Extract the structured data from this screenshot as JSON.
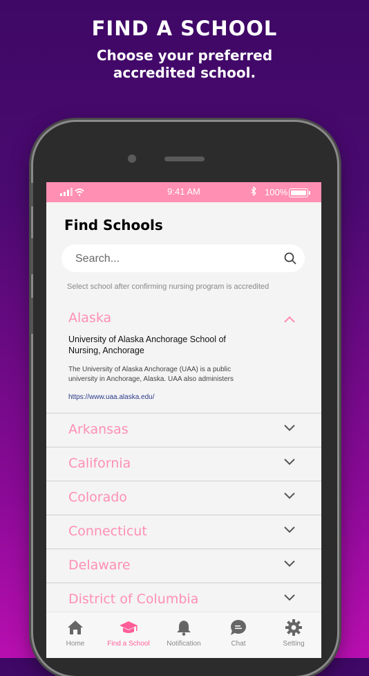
{
  "hero": {
    "title": "FIND A SCHOOL",
    "subtitle_line1": "Choose your preferred",
    "subtitle_line2": "accredited school."
  },
  "status_bar": {
    "time": "9:41 AM",
    "battery": "100%",
    "icons": [
      "signal-icon",
      "wifi-icon",
      "bluetooth-icon",
      "battery-icon"
    ]
  },
  "page": {
    "title": "Find Schools",
    "search_placeholder": "Search...",
    "note": "Select school after confirming nursing program is accredited"
  },
  "expanded_state": {
    "name": "Alaska",
    "school_name": "University of Alaska Anchorage School of Nursing, Anchorage",
    "description": "The University of Alaska Anchorage (UAA) is a public university in Anchorage, Alaska. UAA also administers",
    "link": "https://www.uaa.alaska.edu/"
  },
  "states": [
    "Arkansas",
    "California",
    "Colorado",
    "Connecticut",
    "Delaware",
    "District of Columbia"
  ],
  "tabs": [
    {
      "label": "Home",
      "icon": "home-icon",
      "active": false
    },
    {
      "label": "Find a School",
      "icon": "graduation-cap-icon",
      "active": true
    },
    {
      "label": "Notification",
      "icon": "bell-icon",
      "active": false
    },
    {
      "label": "Chat",
      "icon": "chat-icon",
      "active": false
    },
    {
      "label": "Setting",
      "icon": "gear-icon",
      "active": false
    }
  ],
  "colors": {
    "accent": "#ff8fb3",
    "active_tab": "#ff5e98",
    "link": "#2a3a8a",
    "background_top": "#3f0866",
    "background_bottom": "#b80fb0"
  }
}
